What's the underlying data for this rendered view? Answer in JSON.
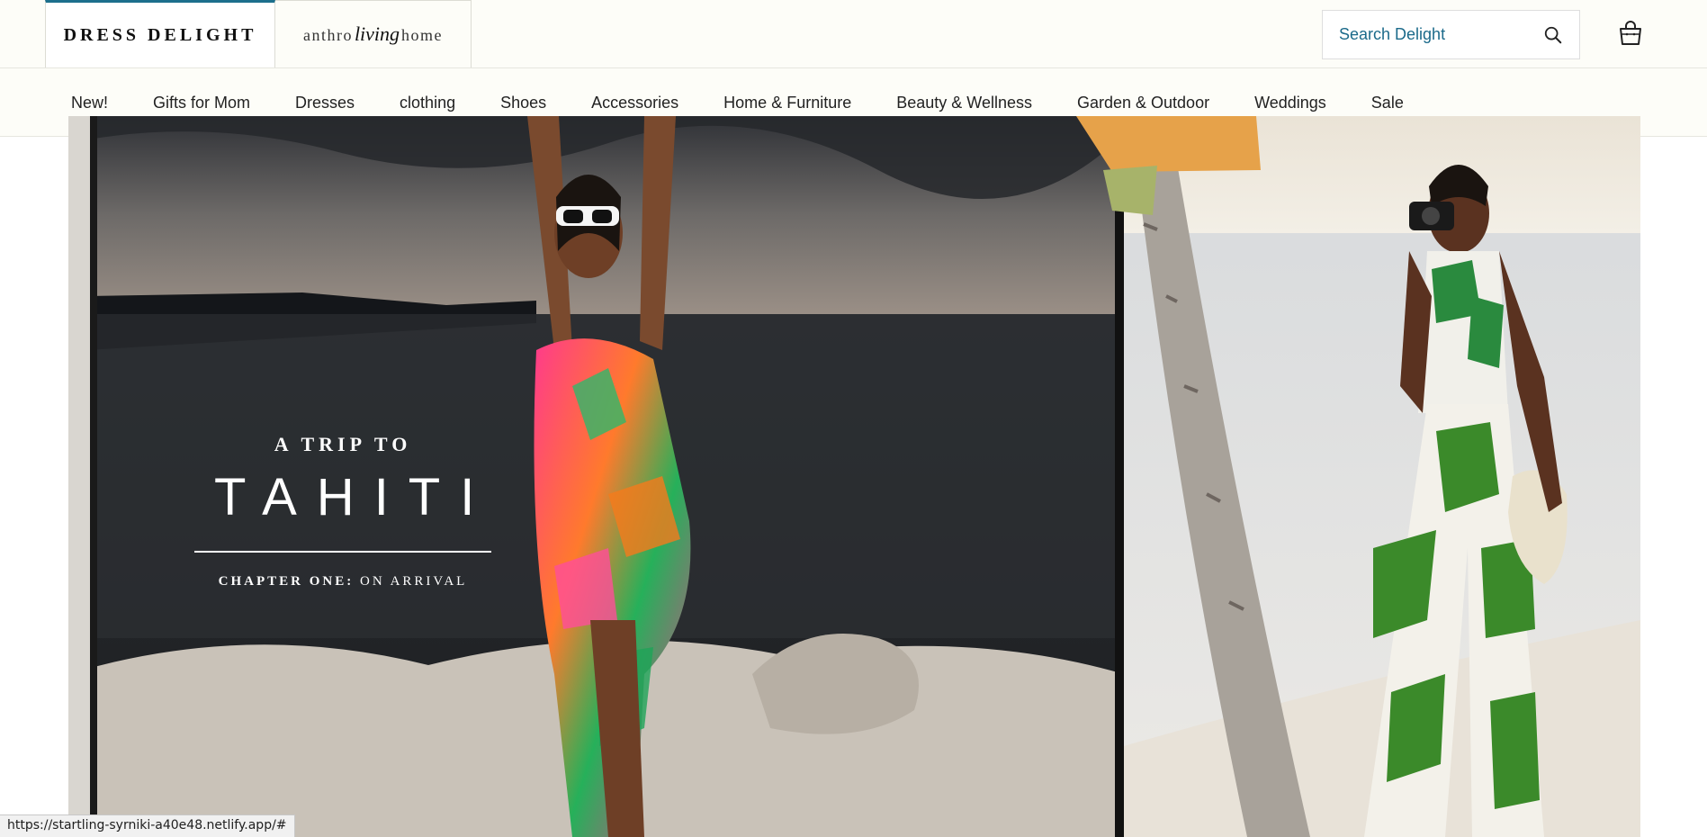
{
  "header": {
    "brands": [
      {
        "label": "DRESS DELIGHT"
      },
      {
        "label_left": "anthro",
        "label_script": "living",
        "label_right": "home"
      }
    ],
    "search": {
      "placeholder": "Search Delight",
      "icon": "search-icon"
    },
    "cart": {
      "icon": "shopping-bag-icon"
    }
  },
  "nav": {
    "items": [
      "New!",
      "Gifts for Mom",
      "Dresses",
      "clothing",
      "Shoes",
      "Accessories",
      "Home & Furniture",
      "Beauty & Wellness",
      "Garden & Outdoor",
      "Weddings",
      "Sale"
    ]
  },
  "hero": {
    "eyebrow": "A TRIP TO",
    "headline": "TAHITI",
    "chapter_label": "CHAPTER ONE:",
    "chapter_title": "ON ARRIVAL"
  },
  "status_bar": {
    "url": "https://startling-syrniki-a40e48.netlify.app/#"
  },
  "colors": {
    "accent": "#1c6f8c",
    "header_bg": "#fdfdf8"
  }
}
